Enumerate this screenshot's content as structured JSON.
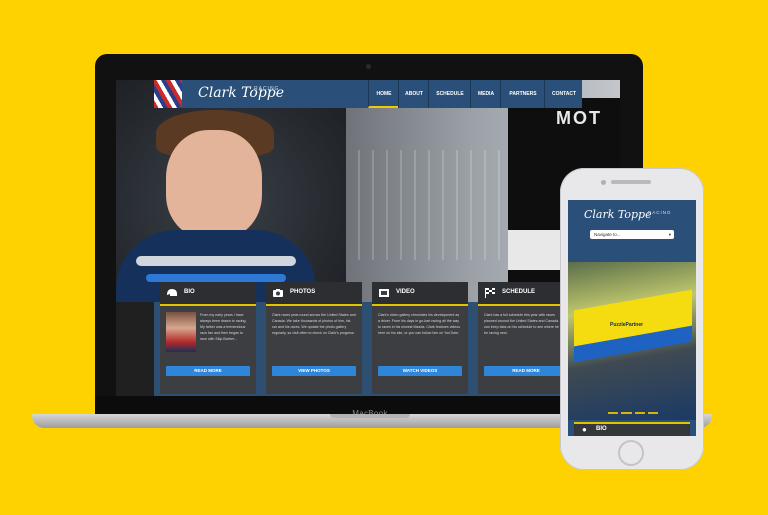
{
  "laptop": {
    "brand": "MacBook"
  },
  "site": {
    "logo": "Clark Toppe",
    "logo_tag": "RACING",
    "hero_sign": "MOT",
    "nav": [
      {
        "label": "HOME",
        "active": true
      },
      {
        "label": "ABOUT",
        "active": false
      },
      {
        "label": "SCHEDULE",
        "active": false
      },
      {
        "label": "MEDIA",
        "active": false
      },
      {
        "label": "PARTNERS",
        "active": false
      },
      {
        "label": "CONTACT",
        "active": false
      }
    ],
    "cards": [
      {
        "icon": "helmet-icon",
        "title": "BIO",
        "text": "From my early years I have always been drawn to racing. My father was a tremendous race fan and then began to race with Skip Barber...",
        "button": "READ MORE"
      },
      {
        "icon": "camera-icon",
        "title": "PHOTOS",
        "text": "Clark races year-round across the United States and Canada. We take thousands of photos of him, his car and his races. We update the photo gallery regularly, so visit often to check on Clark's progress.",
        "button": "VIEW PHOTOS"
      },
      {
        "icon": "video-icon",
        "title": "VIDEO",
        "text": "Clark's video gallery chronicles his development as a driver. From his days in go-kart racing all the way to races in his newest Mazda. Clark features videos here on his site, or you can follow him on YouTube.",
        "button": "WATCH VIDEOS"
      },
      {
        "icon": "checkered-flag-icon",
        "title": "SCHEDULE",
        "text": "Clark has a full schedule this year with races planned around the United States and Canada. You can keep tabs on his schedule to see where he will be racing next.",
        "button": "READ MORE"
      }
    ]
  },
  "mobile": {
    "logo": "Clark Toppe",
    "logo_tag": "RACING",
    "navigate_placeholder": "Navigate to...",
    "car_sponsor": "PuzzlePartner",
    "first_card_title": "BIO"
  }
}
